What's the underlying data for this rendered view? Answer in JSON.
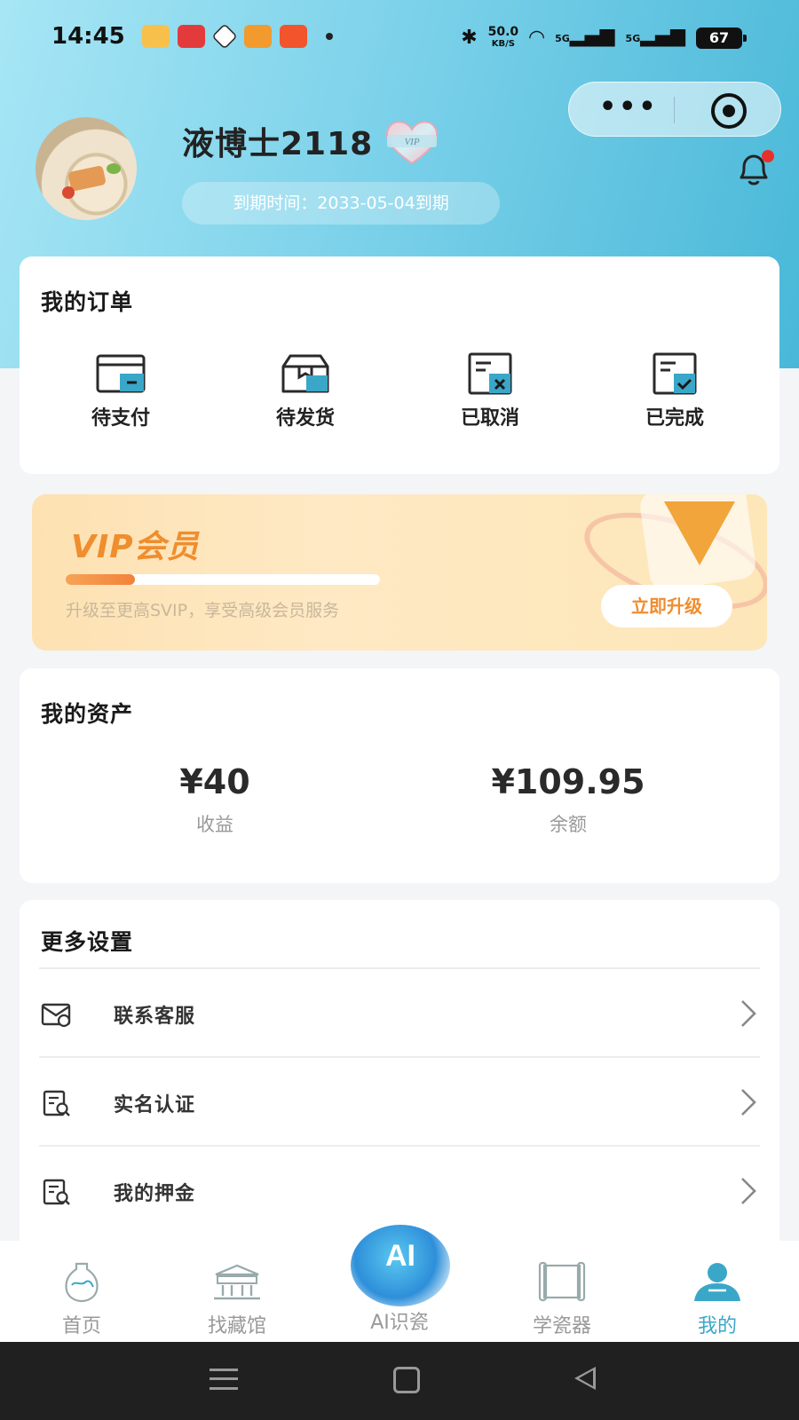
{
  "status_bar": {
    "time": "14:45",
    "net_speed": "50.0",
    "net_unit": "KB/S",
    "signal1": "5G",
    "signal2": "5G",
    "battery": "67"
  },
  "profile": {
    "username": "液博士2118",
    "vip_badge": "VIP",
    "expire_text": "到期时间：2033-05-04到期"
  },
  "orders": {
    "title": "我的订单",
    "items": [
      {
        "label": "待支付",
        "icon": "card-icon"
      },
      {
        "label": "待发货",
        "icon": "box-icon"
      },
      {
        "label": "已取消",
        "icon": "cancel-doc-icon"
      },
      {
        "label": "已完成",
        "icon": "done-doc-icon"
      }
    ]
  },
  "vip": {
    "title": "VIP会员",
    "progress": 0.22,
    "description": "升级至更高SVIP，享受高级会员服务",
    "upgrade_label": "立即升级"
  },
  "assets": {
    "title": "我的资产",
    "items": [
      {
        "amount": "¥40",
        "label": "收益"
      },
      {
        "amount": "¥109.95",
        "label": "余额"
      }
    ]
  },
  "settings": {
    "title": "更多设置",
    "items": [
      {
        "label": "联系客服",
        "icon": "mail-icon"
      },
      {
        "label": "实名认证",
        "icon": "id-search-icon"
      },
      {
        "label": "我的押金",
        "icon": "id-search-icon"
      }
    ]
  },
  "tabbar": {
    "items": [
      {
        "label": "首页",
        "icon": "vase-icon"
      },
      {
        "label": "找藏馆",
        "icon": "museum-icon"
      },
      {
        "label": "AI识瓷",
        "icon": "ai-icon",
        "badge": "AI"
      },
      {
        "label": "学瓷器",
        "icon": "scroll-icon"
      },
      {
        "label": "我的",
        "icon": "user-icon"
      }
    ],
    "active_index": 4
  },
  "colors": {
    "accent": "#3aa7c9",
    "vip_orange": "#f08d2e",
    "notification_dot": "#e8302a"
  }
}
